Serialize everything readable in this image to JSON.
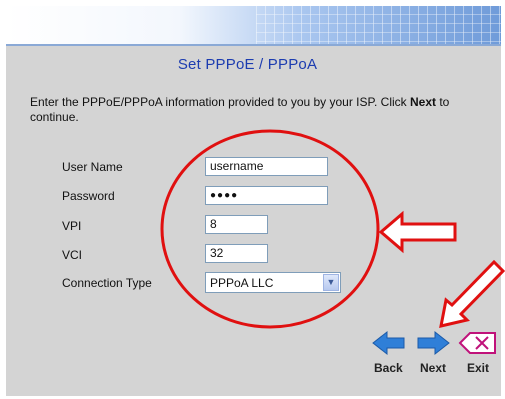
{
  "page": {
    "title": "Set PPPoE / PPPoA",
    "intro_text": "Enter the PPPoE/PPPoA information provided to you by your ISP. Click ",
    "intro_bold": "Next",
    "intro_tail": " to continue."
  },
  "form": {
    "username_label": "User Name",
    "username_value": "username",
    "password_label": "Password",
    "password_value": "●●●●",
    "vpi_label": "VPI",
    "vpi_value": "8",
    "vci_label": "VCI",
    "vci_value": "32",
    "connection_type_label": "Connection Type",
    "connection_type_value": "PPPoA LLC"
  },
  "nav": {
    "back_label": "Back",
    "next_label": "Next",
    "exit_label": "Exit"
  },
  "colors": {
    "title": "#1c3cb0",
    "annotation": "#e01010",
    "arrow_blue": "#2f7fd8",
    "exit_magenta": "#c0127a"
  },
  "icons": [
    "back-arrow-icon",
    "next-arrow-icon",
    "exit-icon",
    "chevron-down-icon"
  ]
}
